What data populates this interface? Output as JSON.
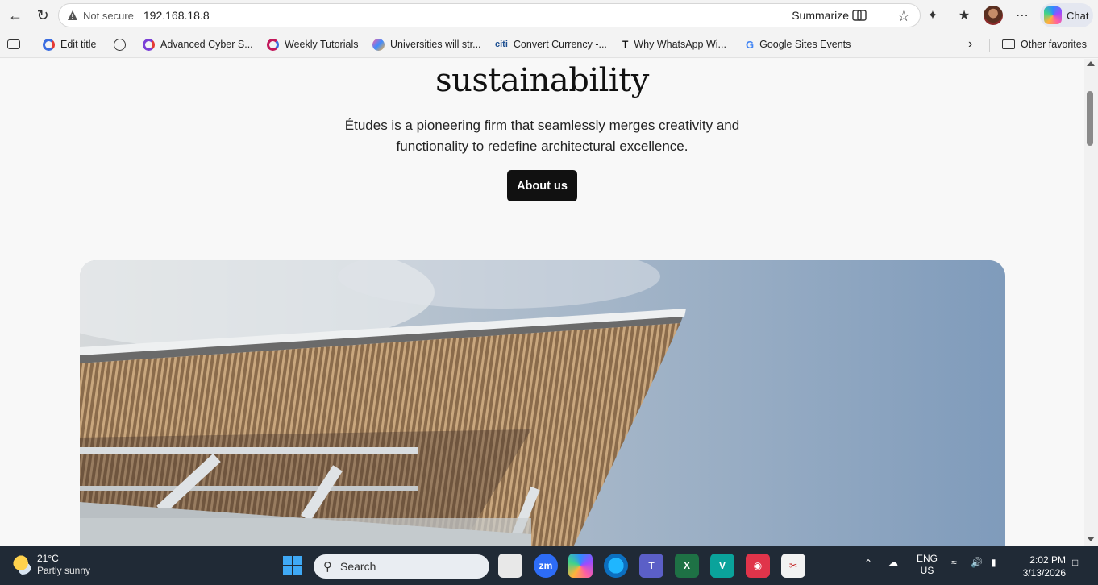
{
  "browser": {
    "security_label": "Not secure",
    "url": "192.168.18.8",
    "summarize_label": "Summarize",
    "chat_label": "Chat"
  },
  "bookmarks": [
    {
      "label": "Edit title",
      "icon": "edit-title-icon",
      "color": "#3b6de0"
    },
    {
      "label": "Advanced Cyber S...",
      "icon": "site-icon",
      "color": "#7a3fd6"
    },
    {
      "label": "Weekly Tutorials",
      "icon": "site-icon",
      "color": "#c2185b"
    },
    {
      "label": "Universities will str...",
      "icon": "butterfly-icon",
      "color": "#3f8cff"
    },
    {
      "label": "Convert Currency -...",
      "icon": "citi-icon",
      "color": "#1d4f91"
    },
    {
      "label": "Why WhatsApp Wi...",
      "icon": "t-icon",
      "color": "#111111"
    },
    {
      "label": "Google Sites Events",
      "icon": "google-icon",
      "color": "#4285f4"
    }
  ],
  "other_favorites": "Other favorites",
  "page": {
    "headline": "sustainability",
    "lead": "Études is a pioneering firm that seamlessly merges creativity and functionality to redefine architectural excellence.",
    "cta": "About us"
  },
  "taskbar": {
    "temp": "21°C",
    "weather": "Partly sunny",
    "search_placeholder": "Search",
    "lang_top": "ENG",
    "lang_bottom": "US",
    "time": "2:02 PM",
    "date": "3/13/2026"
  }
}
